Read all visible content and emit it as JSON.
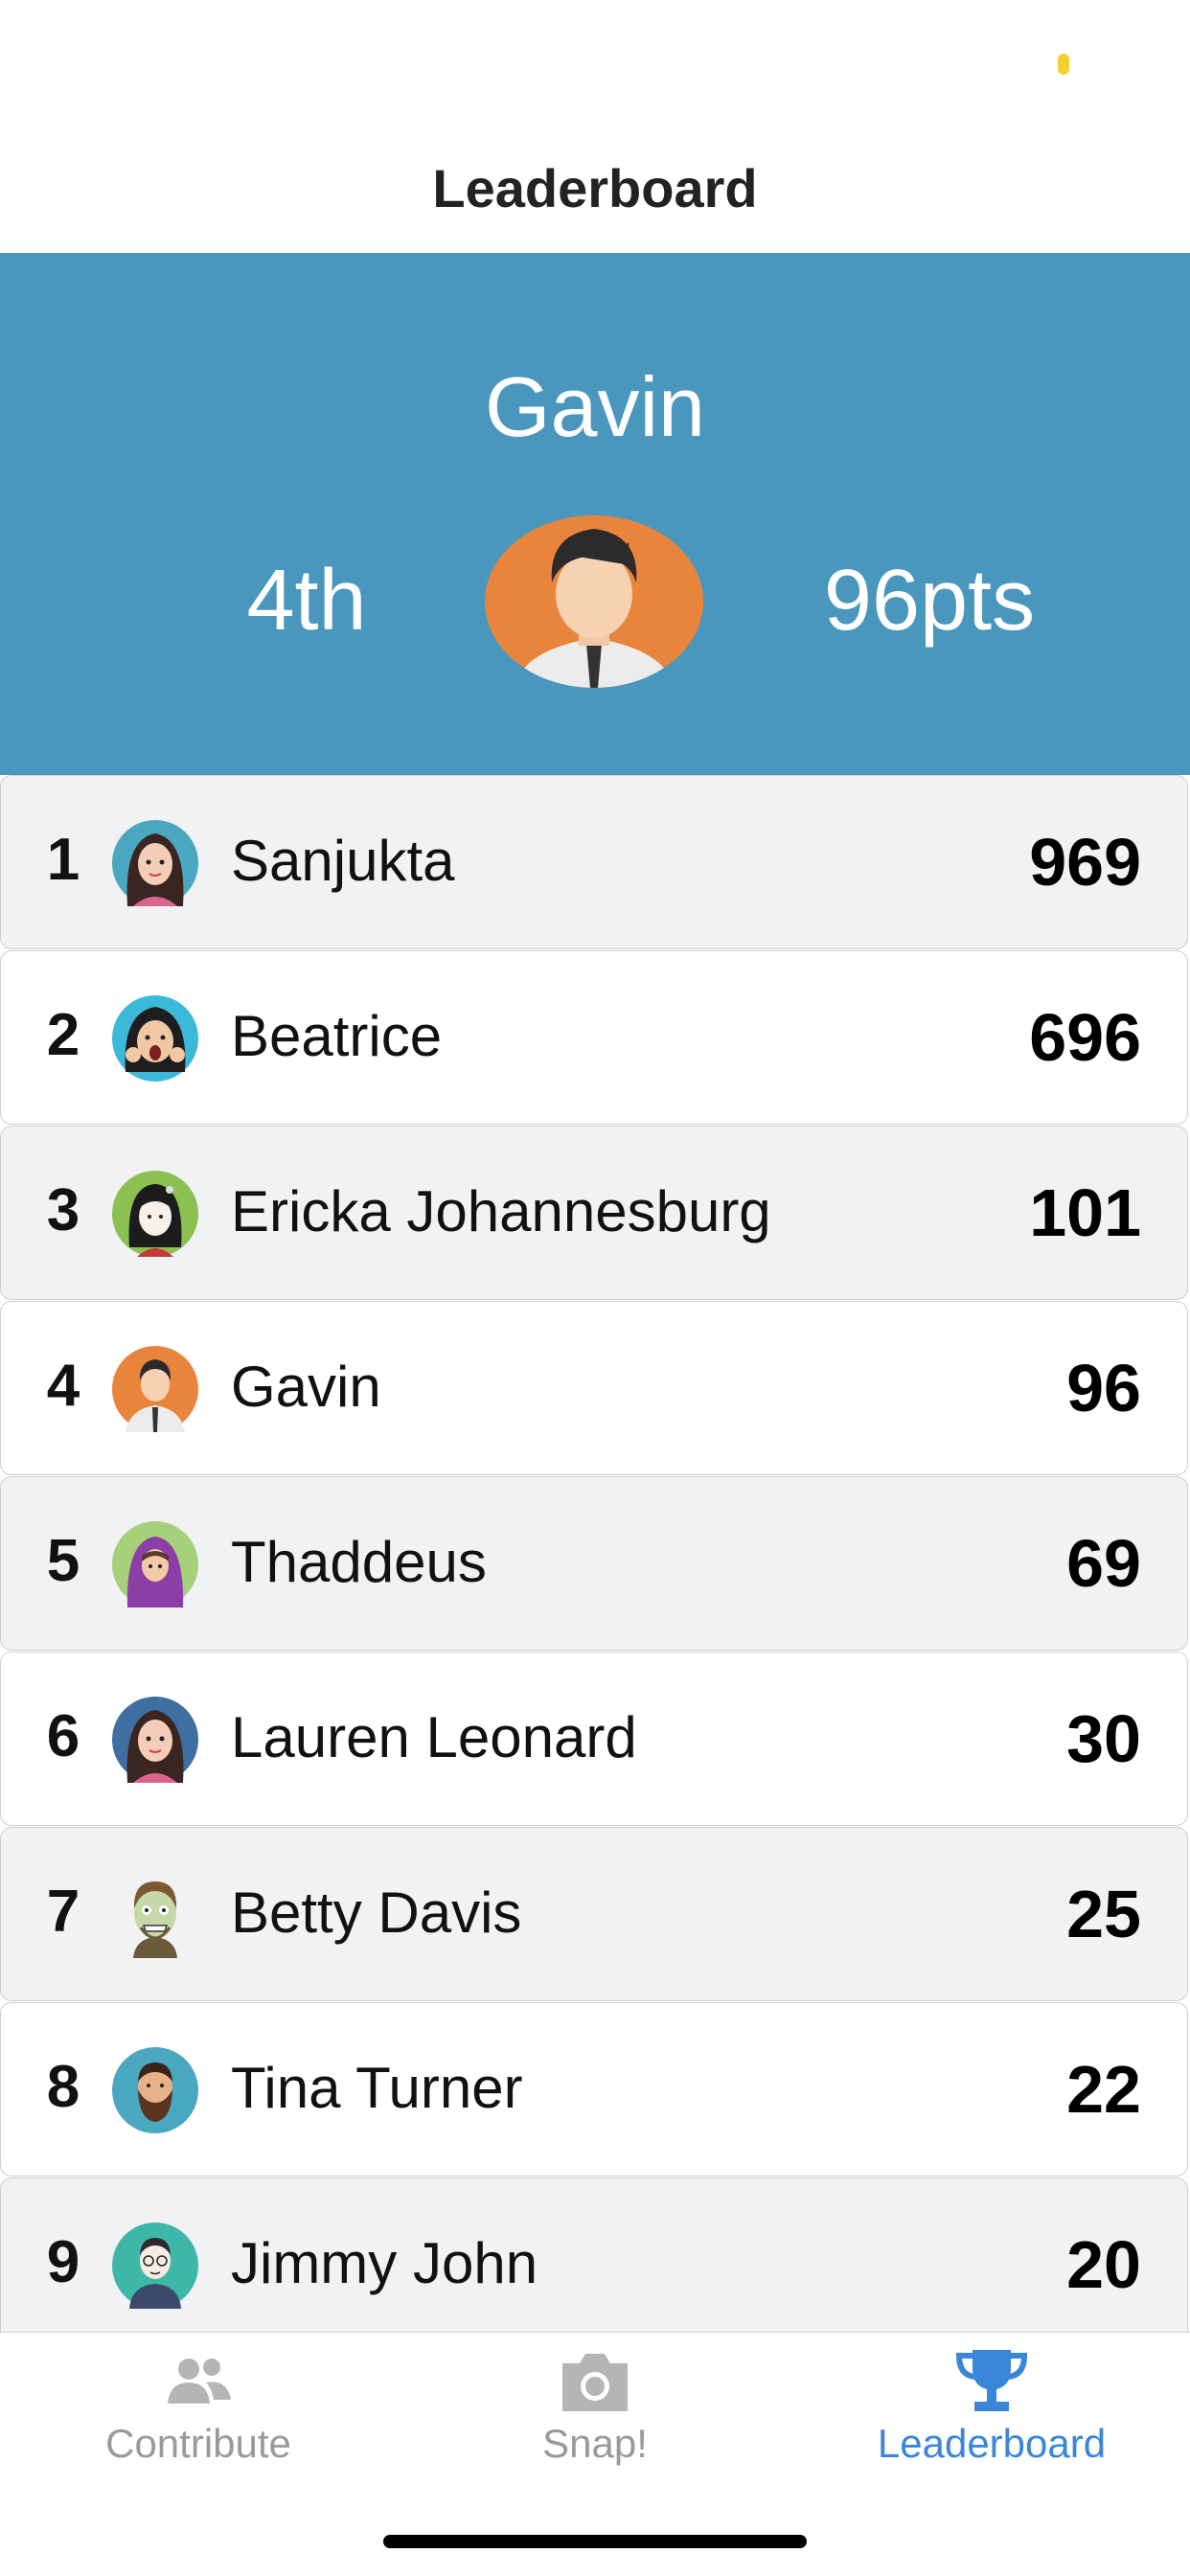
{
  "nav": {
    "title": "Leaderboard"
  },
  "current_user": {
    "name": "Gavin",
    "rank": "4th",
    "points": "96pts"
  },
  "leaderboard": [
    {
      "rank": "1",
      "name": "Sanjukta",
      "score": "969",
      "avatar": "woman-long-hair-avatar-icon"
    },
    {
      "rank": "2",
      "name": "Beatrice",
      "score": "696",
      "avatar": "woman-surprised-avatar-icon"
    },
    {
      "rank": "3",
      "name": "Ericka Johannesburg",
      "score": "101",
      "avatar": "girl-bangs-avatar-icon"
    },
    {
      "rank": "4",
      "name": "Gavin",
      "score": "96",
      "avatar": "man-tie-avatar-icon"
    },
    {
      "rank": "5",
      "name": "Thaddeus",
      "score": "69",
      "avatar": "hooded-person-avatar-icon"
    },
    {
      "rank": "6",
      "name": "Lauren Leonard",
      "score": "30",
      "avatar": "woman-long-hair-avatar-icon"
    },
    {
      "rank": "7",
      "name": "Betty Davis",
      "score": "25",
      "avatar": "zombie-avatar-icon"
    },
    {
      "rank": "8",
      "name": "Tina Turner",
      "score": "22",
      "avatar": "bearded-man-avatar-icon"
    },
    {
      "rank": "9",
      "name": "Jimmy John",
      "score": "20",
      "avatar": "man-glasses-avatar-icon"
    }
  ],
  "tabs": [
    {
      "label": "Contribute",
      "icon": "people-icon",
      "active": false
    },
    {
      "label": "Snap!",
      "icon": "camera-icon",
      "active": false
    },
    {
      "label": "Leaderboard",
      "icon": "trophy-icon",
      "active": true
    }
  ],
  "colors": {
    "hero": "#4a97be",
    "active_tab": "#3a86d8",
    "inactive_tab": "#9a9a9a"
  }
}
